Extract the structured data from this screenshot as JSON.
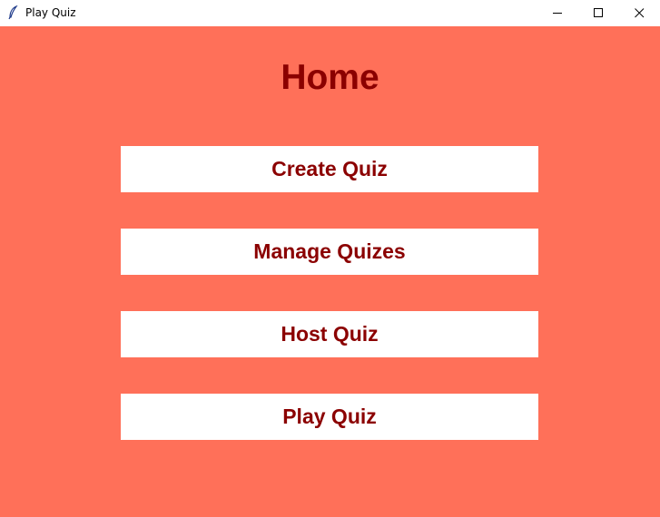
{
  "window": {
    "title": "Play Quiz",
    "icon": "feather-icon",
    "controls": [
      "minimize-icon",
      "maximize-icon",
      "close-icon"
    ]
  },
  "page": {
    "title": "Home",
    "background_color": "#ff7059",
    "accent_color": "#8b0000",
    "button_color": "#ffffff"
  },
  "menu": {
    "create_quiz": "Create Quiz",
    "manage_quizes": "Manage Quizes",
    "host_quiz": "Host Quiz",
    "play_quiz": "Play Quiz"
  }
}
